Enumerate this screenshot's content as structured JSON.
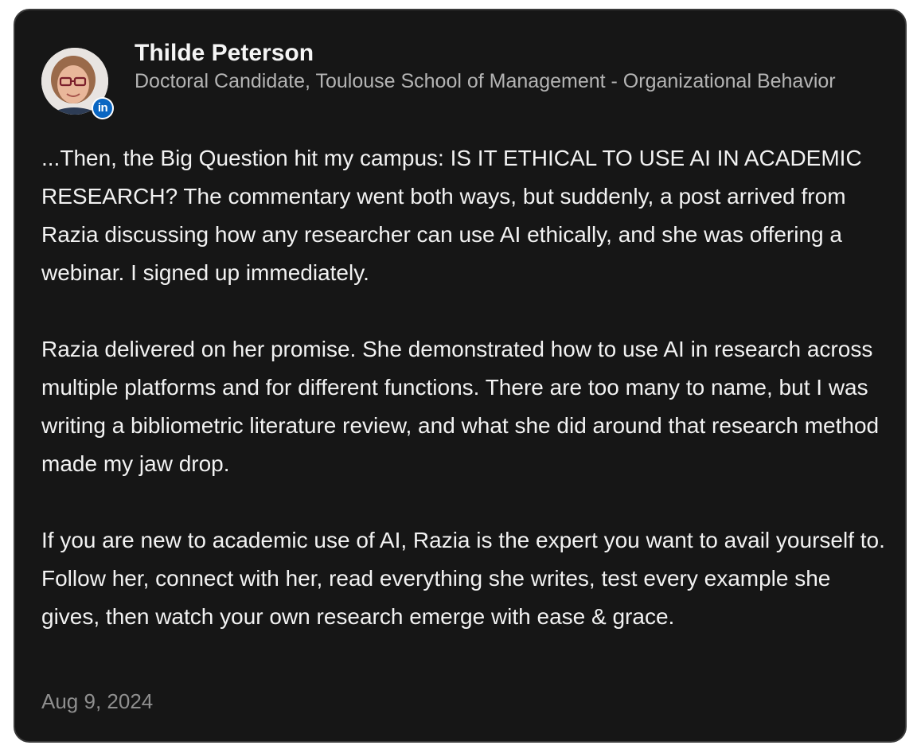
{
  "review": {
    "author": {
      "name": "Thilde Peterson",
      "headline": "Doctoral Candidate, Toulouse School of Management - Organizational Behavior",
      "avatar_icon": "profile-photo",
      "badge_icon": "linkedin-icon",
      "badge_text": "in"
    },
    "paragraphs": [
      "...Then, the Big Question hit my campus: IS IT ETHICAL TO USE AI IN ACADEMIC RESEARCH? The commentary went both ways, but suddenly, a post arrived from Razia discussing how any researcher can use AI ethically, and she was offering a webinar. I signed up immediately.",
      "Razia delivered on her promise. She demonstrated how to use AI in research across multiple platforms and for different functions. There are too many to name, but I was writing a bibliometric literature review, and what she did around that research method made my jaw drop.",
      "If you are new to academic use of AI, Razia is the expert you want to avail yourself to. Follow her, connect with her, read everything she writes, test every example she gives, then watch your own research emerge with ease & grace."
    ],
    "date": "Aug 9, 2024"
  },
  "colors": {
    "card_background": "#161616",
    "text_primary": "#f2f2f2",
    "text_secondary": "#b4b4b4",
    "text_muted": "#8f8f8f",
    "linkedin_blue": "#0a66c2"
  }
}
